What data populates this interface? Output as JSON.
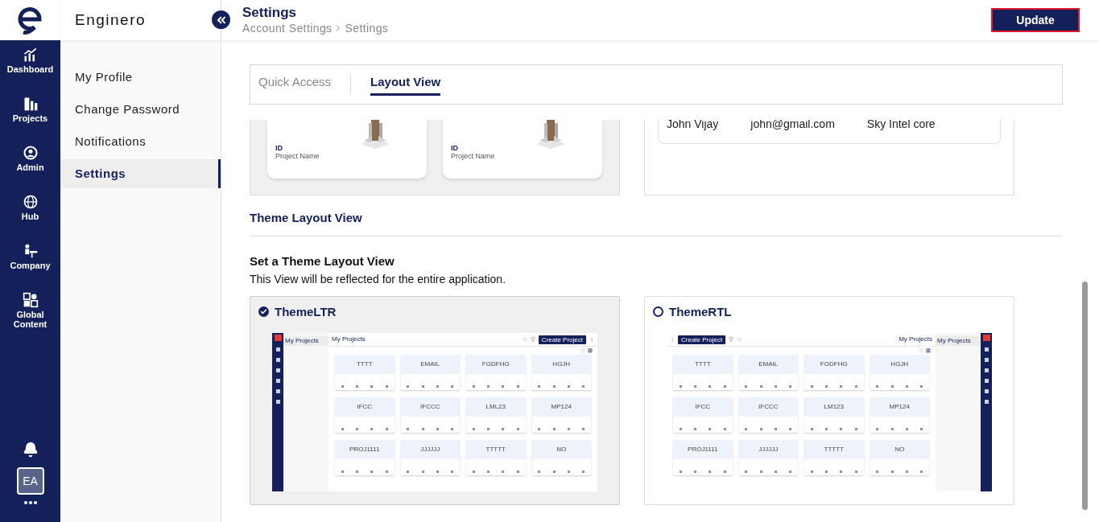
{
  "brand": {
    "name": "Enginero"
  },
  "nav": [
    {
      "label": "Dashboard"
    },
    {
      "label": "Projects"
    },
    {
      "label": "Admin"
    },
    {
      "label": "Hub"
    },
    {
      "label": "Company"
    },
    {
      "label": "Global Content"
    }
  ],
  "user": {
    "initials": "EA"
  },
  "header": {
    "title": "Settings",
    "breadcrumb": [
      "Account Settings",
      "Settings"
    ],
    "update_button": "Update"
  },
  "settings_menu": [
    {
      "label": "My Profile",
      "selected": false
    },
    {
      "label": "Change Password",
      "selected": false
    },
    {
      "label": "Notifications",
      "selected": false
    },
    {
      "label": "Settings",
      "selected": true
    }
  ],
  "tabs": [
    {
      "label": "Quick Access",
      "selected": false
    },
    {
      "label": "Layout View",
      "selected": true
    }
  ],
  "quick_access_preview": {
    "cards": [
      {
        "id": "ID",
        "name": "Project Name"
      },
      {
        "id": "ID",
        "name": "Project Name"
      }
    ],
    "table_row": [
      "John Vijay",
      "john@gmail.com",
      "Sky Intel core"
    ]
  },
  "theme_section": {
    "title": "Theme Layout View",
    "subtitle": "Set a Theme Layout View",
    "description": "This View will be reflected for the entire application.",
    "options": [
      {
        "label": "ThemeLTR",
        "selected": true,
        "kind": "ltr",
        "preview": {
          "page_title": "My Projects",
          "create_button": "Create Project",
          "sidebar_item": "My Projects",
          "cards": [
            "TTTT",
            "EMAIL",
            "FGDFHG",
            "HGJH",
            "IFCC",
            "IFCCC",
            "LML23",
            "MP124",
            "PROJ1111",
            "JJJJJJ",
            "TTTTT",
            "NO"
          ]
        }
      },
      {
        "label": "ThemeRTL",
        "selected": false,
        "kind": "rtl",
        "preview": {
          "page_title": "My Projects",
          "create_button": "Create Project",
          "sidebar_item": "My Projects",
          "cards": [
            "TTTT",
            "EMAIL",
            "FGDFHG",
            "HGJH",
            "IFCC",
            "IFCCC",
            "LM123",
            "MP124",
            "PROJ1111",
            "JJJJJJ",
            "TTTTT",
            "NO"
          ]
        }
      }
    ]
  }
}
